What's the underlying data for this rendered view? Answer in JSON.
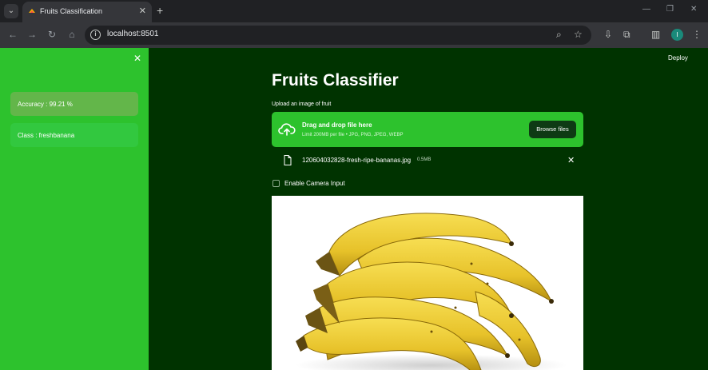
{
  "browser": {
    "tab_title": "Fruits Classification",
    "url": "localhost:8501",
    "profile_initial": "I"
  },
  "sidebar": {
    "accuracy_text": "Accuracy : 99.21 %",
    "class_text": "Class : freshbanana"
  },
  "header": {
    "deploy_label": "Deploy"
  },
  "main": {
    "title": "Fruits Classifier",
    "upload_label": "Upload an image of fruit",
    "dropzone_title": "Drag and drop file here",
    "dropzone_limit": "Limit 200MB per file • JPG, PNG, JPEG, WEBP",
    "browse_label": "Browse files",
    "file_name": "120604032828-fresh-ripe-bananas.jpg",
    "file_size": "0.5MB",
    "camera_label": "Enable Camera Input"
  },
  "colors": {
    "sidebar_bg": "#2dc22d",
    "main_bg": "#003300",
    "accent": "#2dc22d"
  }
}
